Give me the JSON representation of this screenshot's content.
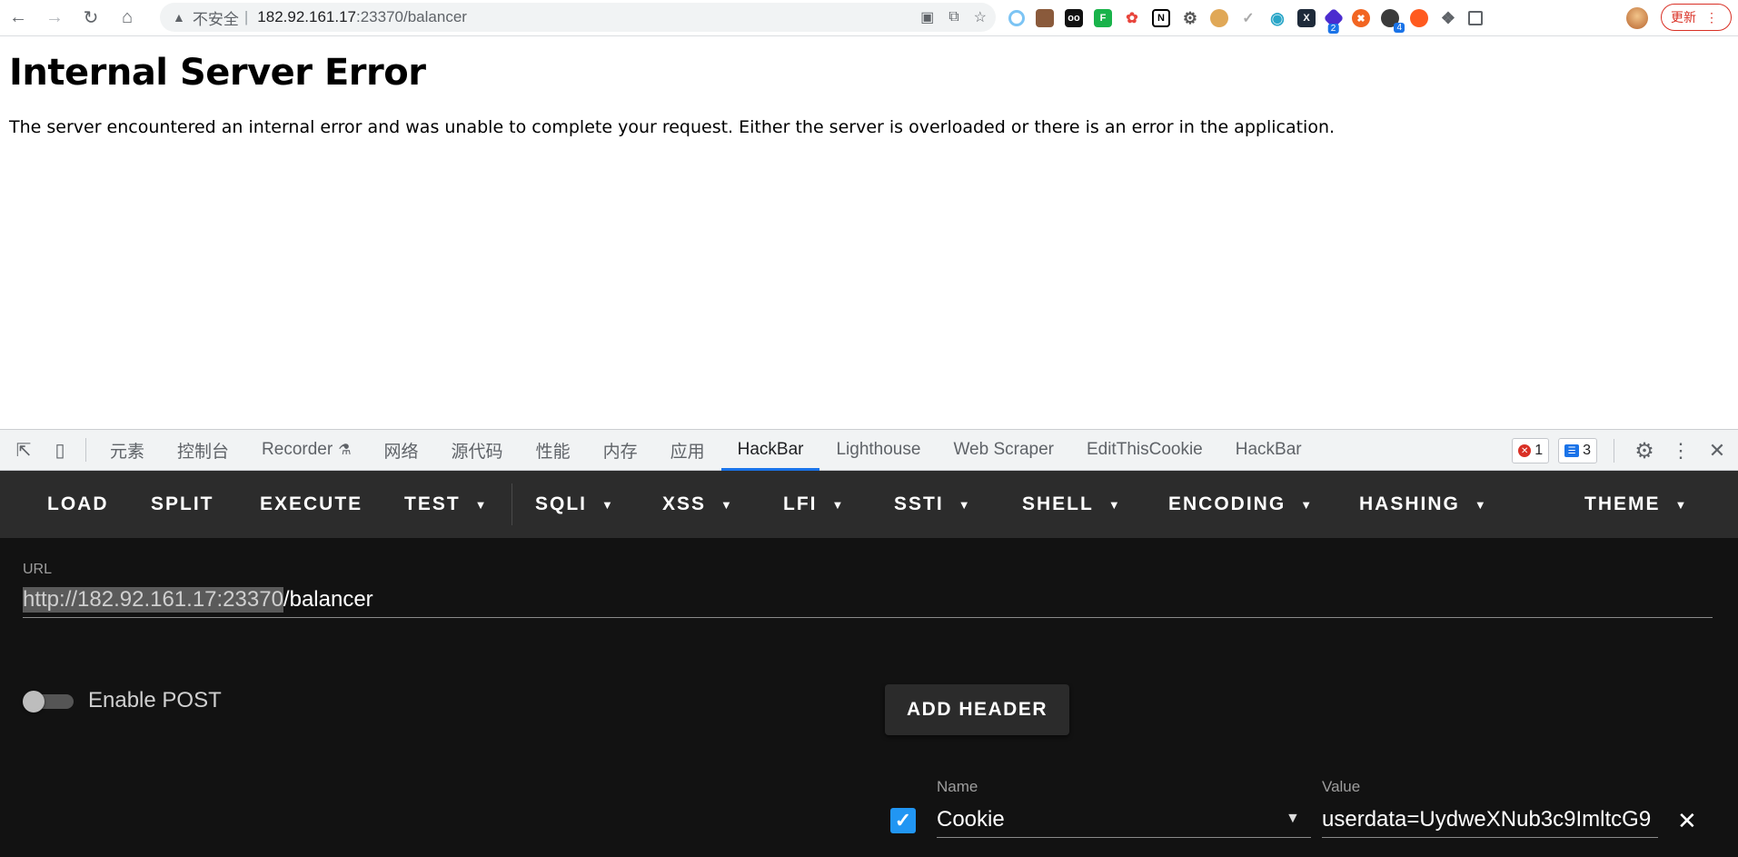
{
  "browser": {
    "insecure_label": "不安全",
    "url_host": "182.92.161.17",
    "url_rest": ":23370/balancer",
    "update_label": "更新",
    "ext_badges": [
      "2",
      "4"
    ]
  },
  "page": {
    "title": "Internal Server Error",
    "message": "The server encountered an internal error and was unable to complete your request. Either the server is overloaded or there is an error in the application."
  },
  "devtools": {
    "tabs": [
      "元素",
      "控制台",
      "Recorder",
      "网络",
      "源代码",
      "性能",
      "内存",
      "应用",
      "HackBar",
      "Lighthouse",
      "Web Scraper",
      "EditThisCookie",
      "HackBar"
    ],
    "active_tab": "HackBar",
    "errors": "1",
    "messages": "3"
  },
  "hackbar": {
    "menu": {
      "load": "LOAD",
      "split": "SPLIT",
      "execute": "EXECUTE",
      "test": "TEST",
      "sqli": "SQLI",
      "xss": "XSS",
      "lfi": "LFI",
      "ssti": "SSTI",
      "shell": "SHELL",
      "encoding": "ENCODING",
      "hashing": "HASHING",
      "theme": "THEME"
    },
    "url_label": "URL",
    "url_selected": "http://182.92.161.17:23370",
    "url_rest": "/balancer",
    "enable_post_label": "Enable POST",
    "enable_post": false,
    "add_header_label": "ADD HEADER",
    "header": {
      "enabled": true,
      "name_label": "Name",
      "name": "Cookie",
      "value_label": "Value",
      "value": "userdata=UydweXNub3c9ImltcG9"
    }
  },
  "colors": {
    "hackbar_menu_bg": "#2c2c2c",
    "hackbar_body_bg": "#121212",
    "checkbox_blue": "#2196f3",
    "devtools_active": "#1a73e8",
    "update_red": "#d93025"
  }
}
